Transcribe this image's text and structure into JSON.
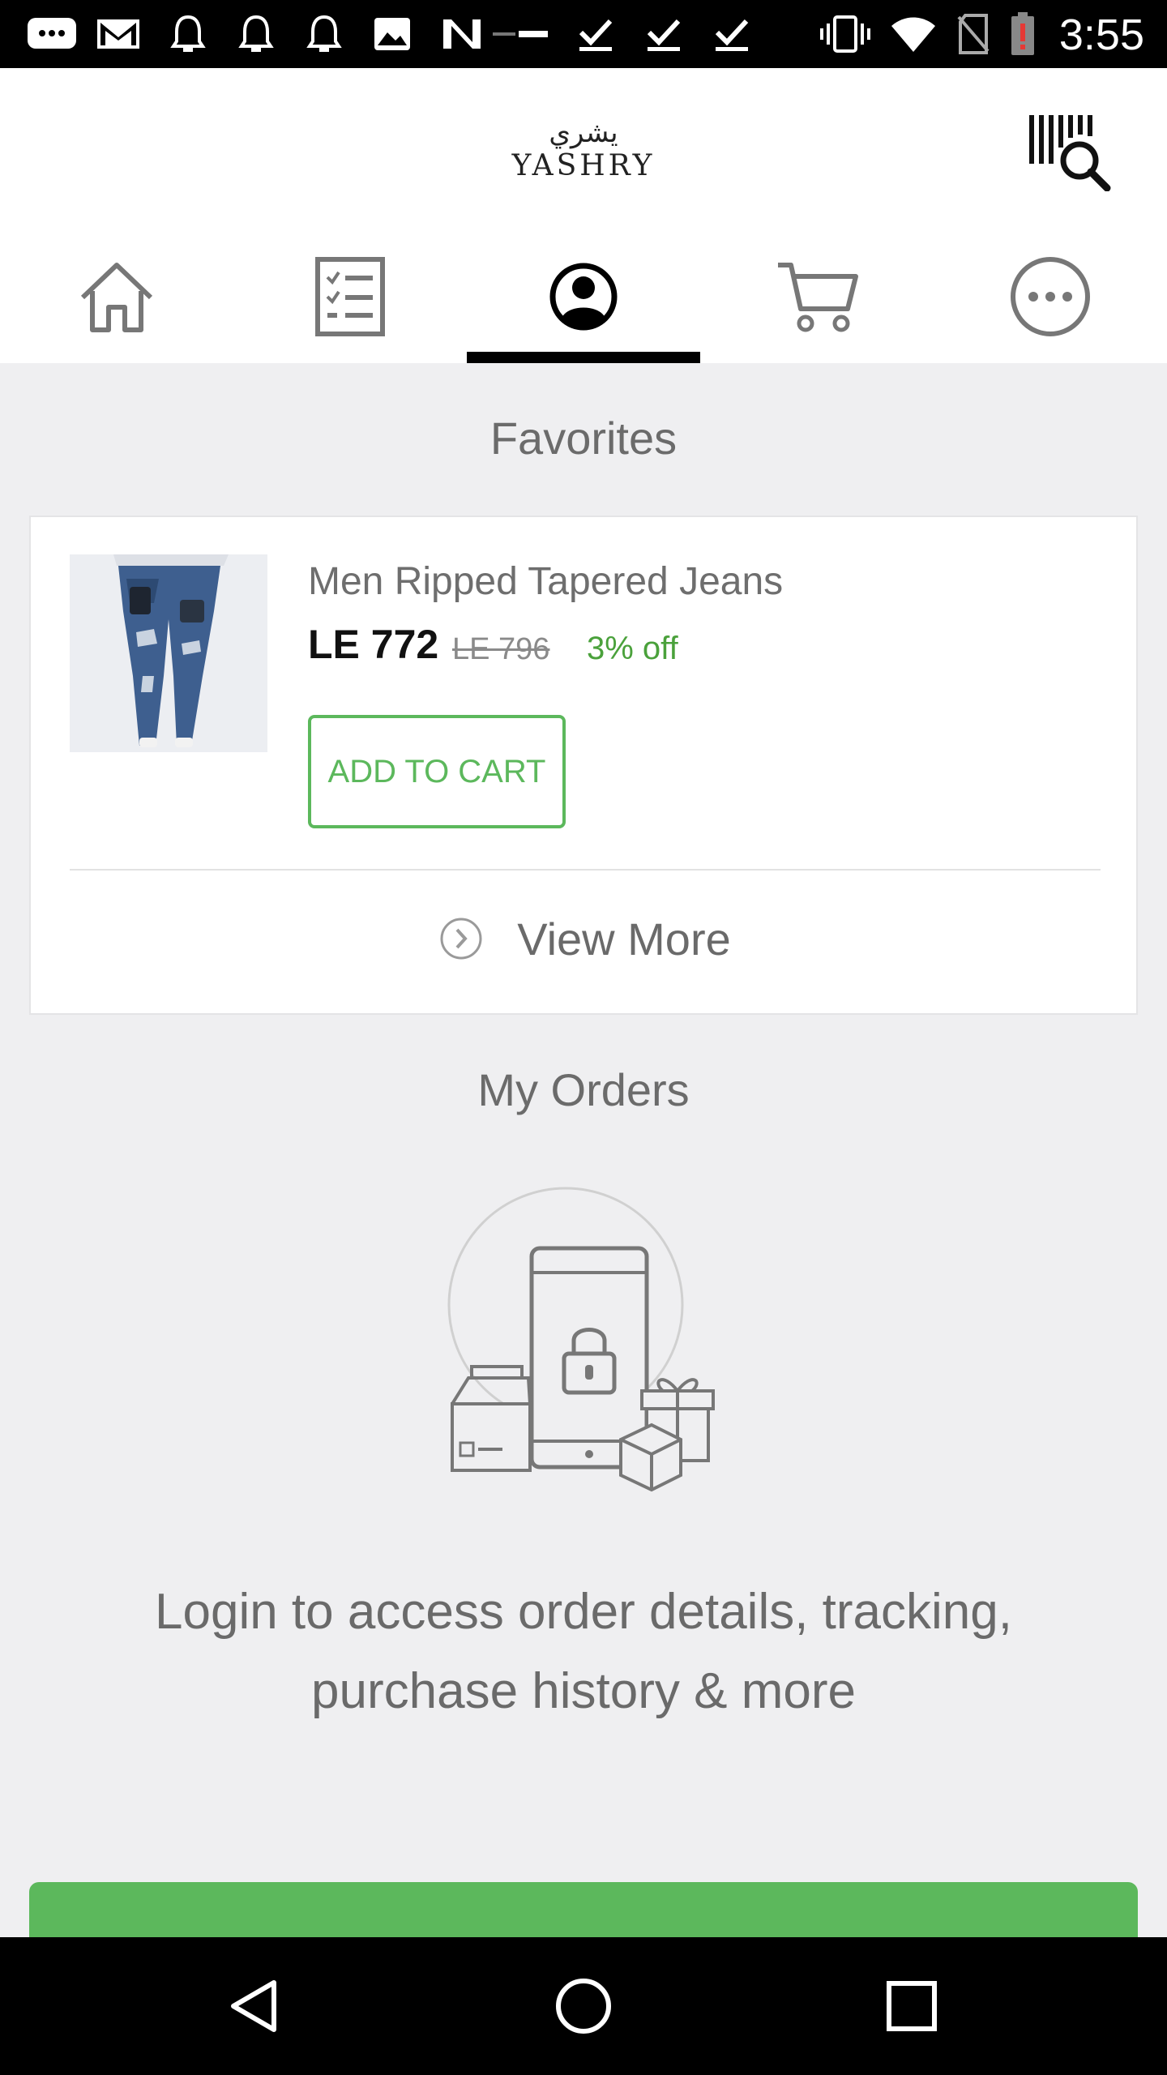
{
  "status_bar": {
    "time": "3:55",
    "icons": [
      "messages-icon",
      "gmail-icon",
      "bell-icon",
      "bell-icon",
      "bell-icon",
      "image-icon",
      "n-app-icon",
      "fashion-nova-icon",
      "download-done-icon",
      "download-done-icon",
      "download-done-icon",
      "vibrate-icon",
      "wifi-icon",
      "no-sim-icon",
      "battery-low-icon"
    ]
  },
  "header": {
    "logo_arabic": "يشري",
    "logo_english": "YASHRY",
    "barcode_search_icon": "barcode-search-icon"
  },
  "tabs": [
    {
      "name": "home",
      "icon": "home-icon",
      "selected": false
    },
    {
      "name": "orders-list",
      "icon": "checklist-icon",
      "selected": false
    },
    {
      "name": "account",
      "icon": "account-icon",
      "selected": true
    },
    {
      "name": "cart",
      "icon": "cart-icon",
      "selected": false
    },
    {
      "name": "more",
      "icon": "more-icon",
      "selected": false
    }
  ],
  "favorites": {
    "title": "Favorites",
    "product": {
      "name": "Men Ripped Tapered Jeans",
      "price": "LE  772",
      "old_price": "LE 796",
      "discount": "3% off",
      "add_to_cart_label": "ADD TO CART"
    },
    "view_more_label": "View More"
  },
  "orders": {
    "title": "My Orders",
    "login_message": "Login to access order details, tracking, purchase history & more"
  },
  "colors": {
    "accent_green": "#5cb85c",
    "discount_green": "#4aa13b",
    "background": "#efeff1"
  }
}
